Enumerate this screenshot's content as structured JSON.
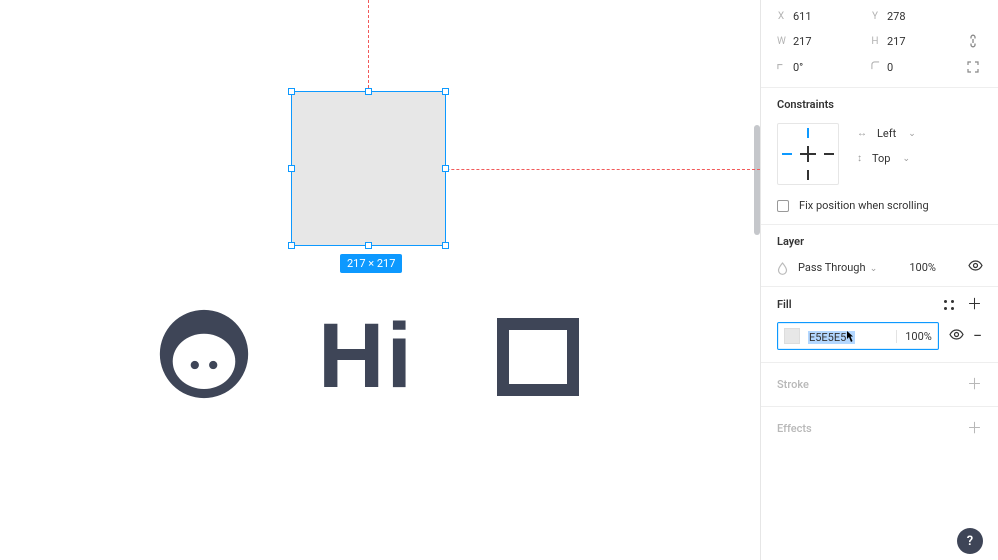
{
  "canvas": {
    "selection_dimensions": "217 × 217",
    "hi_text": "Hi"
  },
  "transform": {
    "x_label": "X",
    "x": "611",
    "y_label": "Y",
    "y": "278",
    "w_label": "W",
    "w": "217",
    "h_label": "H",
    "h": "217",
    "rot_label": "",
    "rotation": "0°",
    "corner_label": "",
    "corner": "0"
  },
  "constraints": {
    "title": "Constraints",
    "horizontal": "Left",
    "vertical": "Top",
    "fix_label": "Fix position when scrolling"
  },
  "layer": {
    "title": "Layer",
    "blend": "Pass Through",
    "opacity": "100%"
  },
  "fill": {
    "title": "Fill",
    "hex": "E5E5E5",
    "opacity": "100%"
  },
  "stroke": {
    "title": "Stroke"
  },
  "effects": {
    "title": "Effects"
  },
  "help": "?"
}
